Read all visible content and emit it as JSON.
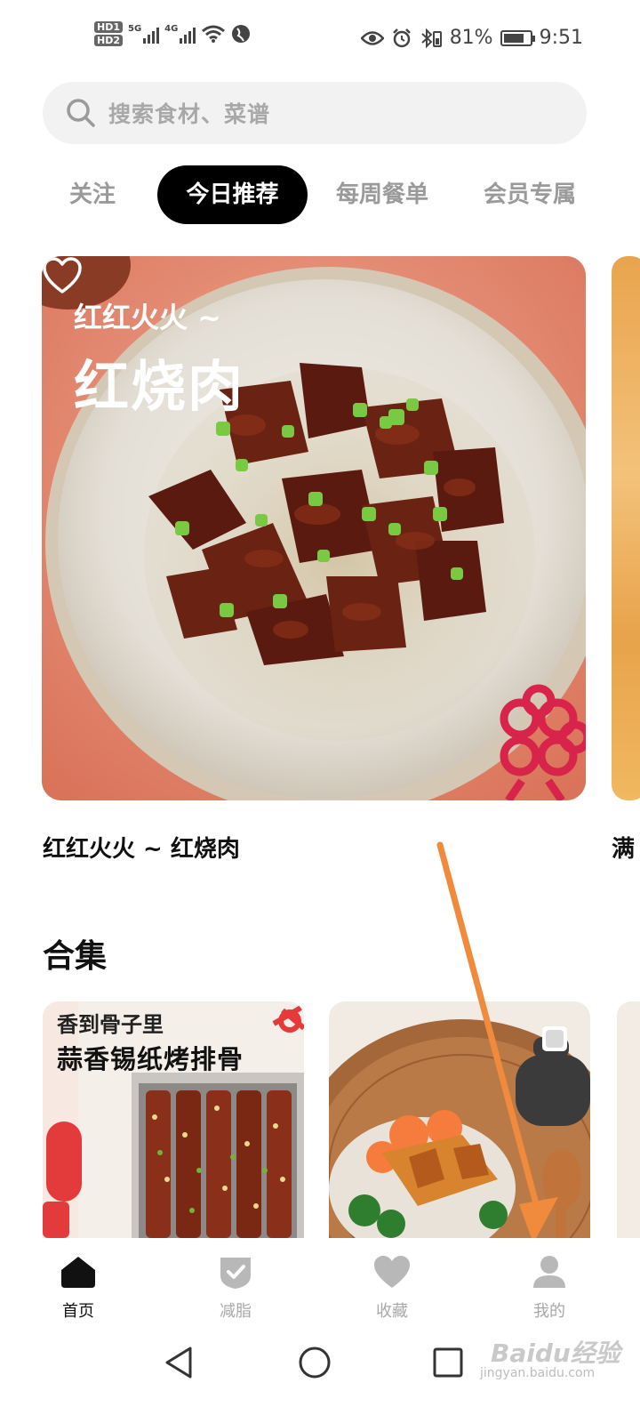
{
  "status_bar": {
    "sim1": "HD1",
    "sim2": "HD2",
    "net1": "5G",
    "net2": "4G",
    "battery_percent": "81%",
    "battery_level": 0.81,
    "time": "9:51"
  },
  "search": {
    "placeholder": "搜索食材、菜谱"
  },
  "tabs": [
    {
      "label": "关注",
      "active": false
    },
    {
      "label": "今日推荐",
      "active": true
    },
    {
      "label": "每周餐单",
      "active": false
    },
    {
      "label": "会员专属",
      "active": false
    }
  ],
  "featured": {
    "eyebrow": "红红火火 ~",
    "title": "红烧肉",
    "caption": "红红火火 ~ 红烧肉",
    "next_caption": "满"
  },
  "collection": {
    "title": "合集",
    "cards": [
      {
        "line1": "香到骨子里",
        "line2": "蒜香锡纸烤排骨"
      },
      {
        "line1": "",
        "line2": ""
      }
    ]
  },
  "bottom_nav": [
    {
      "label": "首页",
      "icon": "home-icon",
      "active": true
    },
    {
      "label": "减脂",
      "icon": "shield-check-icon",
      "active": false
    },
    {
      "label": "收藏",
      "icon": "heart-icon",
      "active": false
    },
    {
      "label": "我的",
      "icon": "person-icon",
      "active": false
    }
  ],
  "watermark": {
    "brand": "Baidu经验",
    "url": "jingyan.baidu.com"
  },
  "colors": {
    "accent_arrow": "#f08a3c",
    "tab_active_bg": "#000000",
    "card_bg": "#e8907a"
  }
}
